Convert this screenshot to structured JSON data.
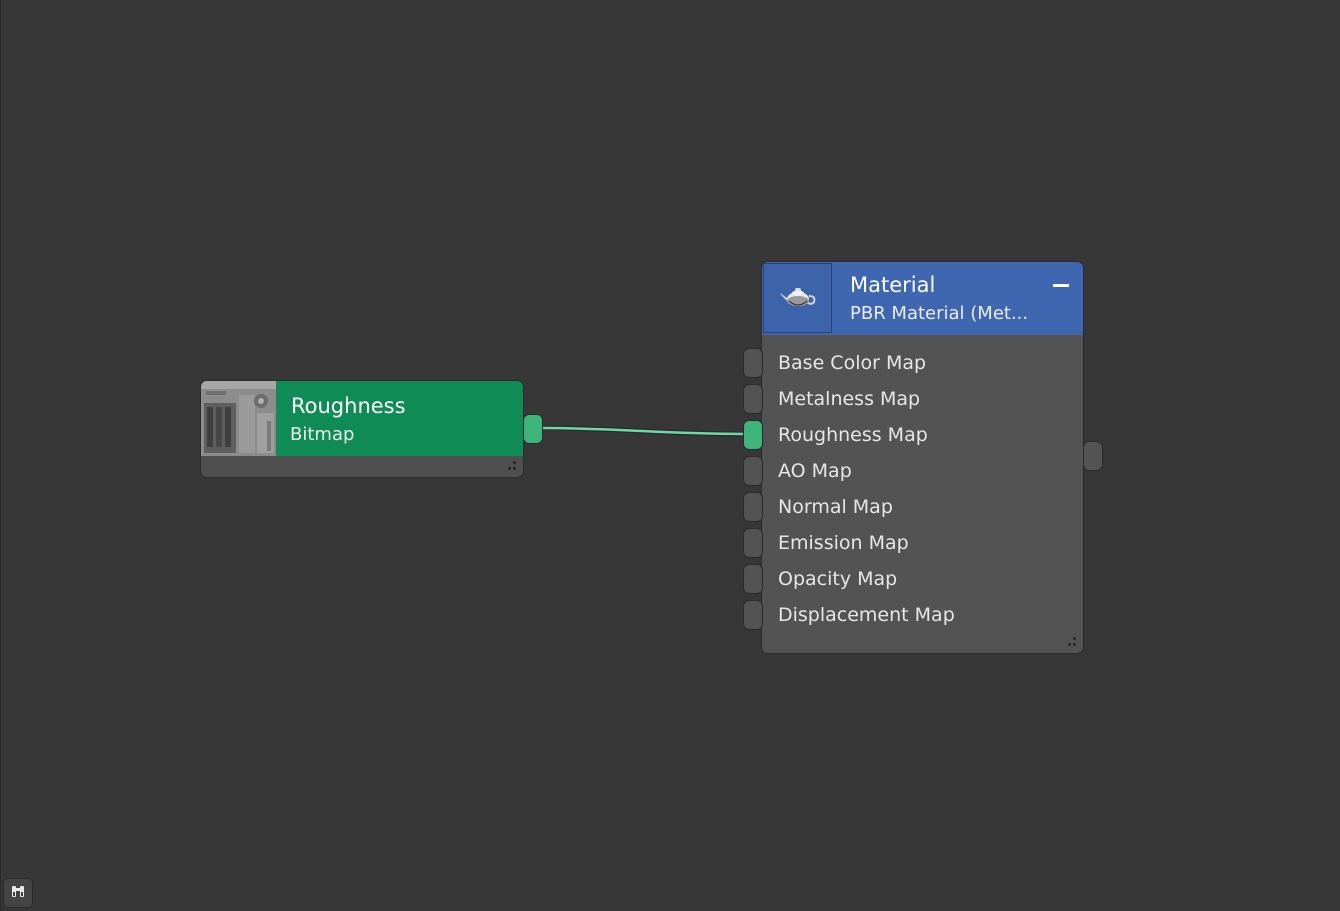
{
  "graph": {
    "bitmap_node": {
      "title": "Roughness",
      "subtitle": "Bitmap",
      "color": "#0f8c55",
      "thumbnail_icon": "texture-thumbnail"
    },
    "material_node": {
      "title": "Material",
      "subtitle": "PBR Material (Met...",
      "color": "#3e66b1",
      "icon": "teapot-icon",
      "collapse_icon": "minus-icon",
      "slots": [
        {
          "label": "Base Color Map",
          "connected": false
        },
        {
          "label": "Metalness Map",
          "connected": false
        },
        {
          "label": "Roughness Map",
          "connected": true
        },
        {
          "label": "AO Map",
          "connected": false
        },
        {
          "label": "Normal Map",
          "connected": false
        },
        {
          "label": "Emission Map",
          "connected": false
        },
        {
          "label": "Opacity Map",
          "connected": false
        },
        {
          "label": "Displacement Map",
          "connected": false
        }
      ]
    },
    "wire_color": "#5fd3a0"
  },
  "toolbar": {
    "navigator_icon": "binoculars-icon"
  }
}
